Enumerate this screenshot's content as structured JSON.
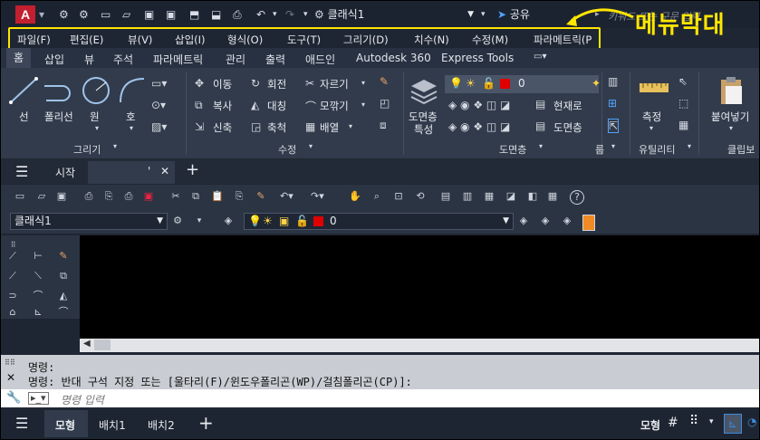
{
  "title_bar": {
    "logo": "A",
    "workspace": "클래식1",
    "share": "공유",
    "search_placeholder": "키워드 또는 구문 입력"
  },
  "annotation": "메뉴막대",
  "menu_bar": {
    "items": [
      "파일(F)",
      "편집(E)",
      "뷰(V)",
      "삽입(I)",
      "형식(O)",
      "도구(T)",
      "그리기(D)",
      "치수(N)",
      "수정(M)",
      "파라메트릭(P"
    ]
  },
  "ribbon_tabs": [
    "홈",
    "삽입",
    "뷰",
    "주석",
    "파라메트릭",
    "관리",
    "출력",
    "애드인",
    "Autodesk 360",
    "Express Tools"
  ],
  "ribbon": {
    "draw": {
      "tools": [
        "선",
        "폴리선",
        "원",
        "호"
      ],
      "label": "그리기"
    },
    "modify": {
      "tools": [
        "이동",
        "회전",
        "자르기",
        "복사",
        "대칭",
        "모깎기",
        "신축",
        "축척",
        "배열"
      ],
      "label": "수정"
    },
    "layers": {
      "layer_props_line1": "도면층",
      "layer_props_line2": "특성",
      "current_layer": "0",
      "set_current": "현재로",
      "layer_match": "도면층",
      "label": "도면층"
    },
    "block": {
      "label": "블록"
    },
    "utility": {
      "measure": "측정",
      "label": "유틸리티"
    },
    "clipboard": {
      "paste": "붙여넣기",
      "label": "클립보"
    }
  },
  "file_tabs": {
    "start": "시작",
    "drawing": "'"
  },
  "toolbar2": {
    "workspace": "클래식1",
    "layer": "0"
  },
  "command": {
    "line1": "명령:",
    "line2": "명령: 반대 구석 지정 또는 [울타리(F)/윈도우폴리곤(WP)/걸침폴리곤(CP)]:",
    "placeholder": "명령 입력"
  },
  "status_bar": {
    "model_tab": "모형",
    "layout1": "배치1",
    "layout2": "배치2",
    "model_button": "모형"
  },
  "colors": {
    "annotation": "#ffe600",
    "logo": "#c21f2f",
    "accent_blue": "#3d8bd9"
  }
}
